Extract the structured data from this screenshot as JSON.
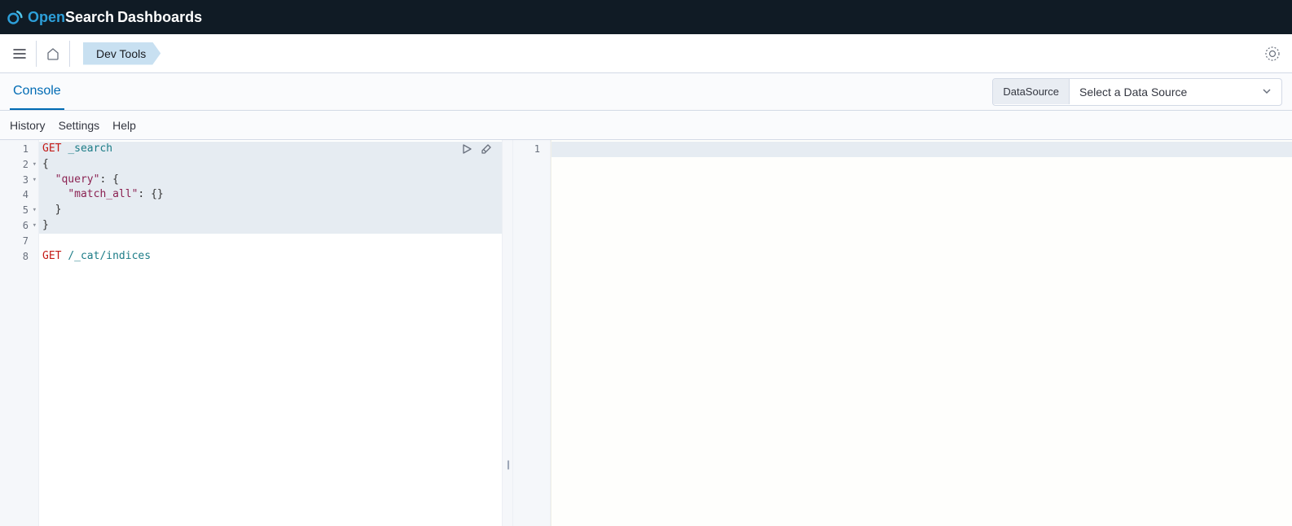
{
  "header": {
    "logo_open": "Open",
    "logo_search": "Search",
    "logo_dashboards": "Dashboards"
  },
  "breadcrumb": {
    "dev_tools": "Dev Tools"
  },
  "tabs": {
    "console": "Console"
  },
  "datasource": {
    "label": "DataSource",
    "placeholder": "Select a Data Source"
  },
  "toolbar": {
    "history": "History",
    "settings": "Settings",
    "help": "Help"
  },
  "editor": {
    "lines": [
      {
        "n": "1",
        "fold": false,
        "tokens": [
          {
            "cls": "tok-method",
            "t": "GET"
          },
          {
            "cls": "",
            "t": " "
          },
          {
            "cls": "tok-path",
            "t": "_search"
          }
        ],
        "hl": true
      },
      {
        "n": "2",
        "fold": true,
        "tokens": [
          {
            "cls": "tok-brace",
            "t": "{"
          }
        ],
        "hl": true
      },
      {
        "n": "3",
        "fold": true,
        "tokens": [
          {
            "cls": "",
            "t": "  "
          },
          {
            "cls": "tok-key",
            "t": "\"query\""
          },
          {
            "cls": "tok-punc",
            "t": ": "
          },
          {
            "cls": "tok-brace",
            "t": "{"
          }
        ],
        "hl": true
      },
      {
        "n": "4",
        "fold": false,
        "tokens": [
          {
            "cls": "",
            "t": "    "
          },
          {
            "cls": "tok-key",
            "t": "\"match_all\""
          },
          {
            "cls": "tok-punc",
            "t": ": "
          },
          {
            "cls": "tok-brace",
            "t": "{}"
          }
        ],
        "hl": true
      },
      {
        "n": "5",
        "fold": true,
        "tokens": [
          {
            "cls": "",
            "t": "  "
          },
          {
            "cls": "tok-brace",
            "t": "}"
          }
        ],
        "hl": true
      },
      {
        "n": "6",
        "fold": true,
        "tokens": [
          {
            "cls": "tok-brace",
            "t": "}"
          }
        ],
        "hl": true
      },
      {
        "n": "7",
        "fold": false,
        "tokens": [],
        "hl": false
      },
      {
        "n": "8",
        "fold": false,
        "tokens": [
          {
            "cls": "tok-method",
            "t": "GET"
          },
          {
            "cls": "",
            "t": " "
          },
          {
            "cls": "tok-path",
            "t": "/_cat/indices"
          }
        ],
        "hl": false
      }
    ]
  },
  "output": {
    "lines": [
      {
        "n": "1"
      }
    ]
  }
}
